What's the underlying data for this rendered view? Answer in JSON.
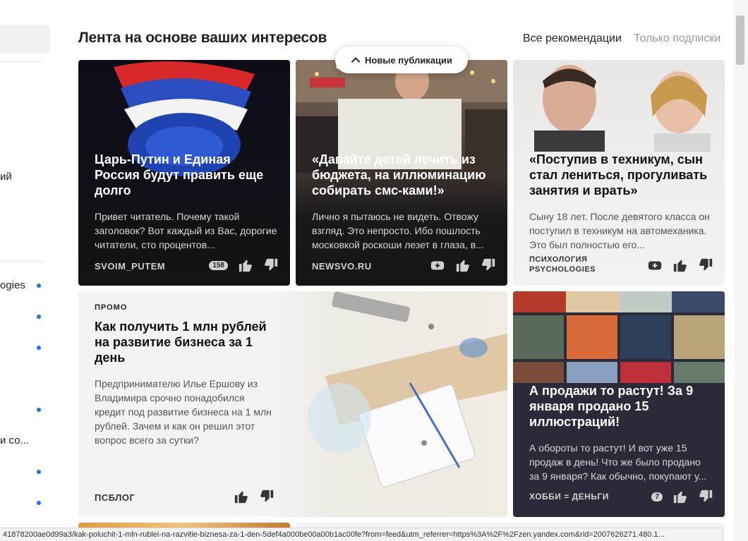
{
  "sidebar": {
    "fragments": [
      {
        "text": "ий"
      },
      {
        "text": "ogies"
      },
      {
        "text": "и со..."
      }
    ]
  },
  "feed": {
    "title": "Лента на основе ваших интересов",
    "tabs": [
      {
        "label": "Все рекомендации",
        "active": true
      },
      {
        "label": "Только подписки",
        "active": false
      }
    ],
    "new_publications_label": "Новые публикации"
  },
  "cards": [
    {
      "title": "Царь-Путин и Единая Россия будут править еще долго",
      "snippet": "Привет читатель. Почему такой заголовок? Вот каждый из Вас, дорогие читатели, сто процентов...",
      "source": "SVOIM_PUTEM",
      "badge": "158"
    },
    {
      "title": "«Давайте детей лечить из бюджета, на иллюминацию собирать смс-ками!»",
      "snippet": "Лично я пытаюсь не видеть. Отвожу взгляд. Это непросто. Ибо пошлость московкой роскоши лезет в глаза, в...",
      "source": "NEWSVO.RU"
    },
    {
      "title": "«Поступив в техникум, сын стал лениться, прогуливать занятия и врать»",
      "snippet": "Сыну 18 лет. После девятого класса он поступил в техникум на автомеханика. Это был полностью его...",
      "source_line1": "ПСИХОЛОГИЯ",
      "source_line2": "PSYCHOLOGIES"
    },
    {
      "promo_label": "ПРОМО",
      "title": "Как получить 1 млн рублей на развитие бизнеса за 1 день",
      "snippet": "Предпринимателю Илье Ершову из Владимира срочно понадобился кредит под развитие бизнеса на 1 млн рублей. Зачем и как он решил этот вопрос всего за сутки?",
      "source": "ПСБЛОГ"
    },
    {
      "title": "А продажи то растут! За 9 января продано 15 иллюстраций!",
      "snippet": "А обороты то растут! И вот уже 15 продаж в день! Что же было продано за 9 января? Как обычно, покупают у...",
      "source": "ХОББИ = ДЕНЬГИ",
      "badge": "7"
    }
  ],
  "status_url": "41878200ae0d99a3/kak-poluchit-1-mln-rublei-na-razvitie-biznesa-za-1-den-5def4a000be00a00b1ac00fe?from=feed&utm_referrer=https%3A%2F%2Fzen.yandex.com&rid=2007626271.480.1...",
  "colors": {
    "accent_blue": "#1a73e8",
    "tab_inactive": "#9a9a9a",
    "dark_card": "#141414"
  }
}
